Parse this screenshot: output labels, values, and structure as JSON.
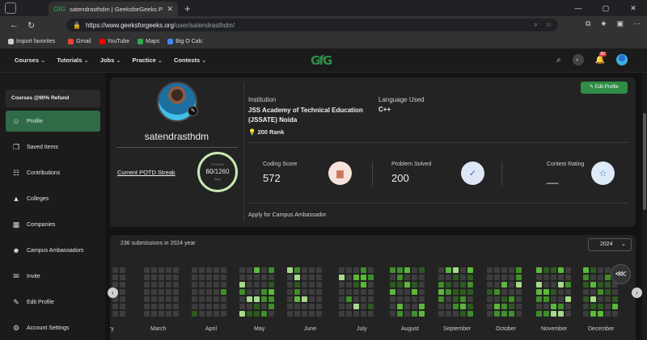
{
  "browser": {
    "tab_title": "satendrasthdm | GeeksforGeeks P",
    "tab_favicon": "GfG",
    "url_host": "https://www.geeksforgeeks.org",
    "url_path": "/user/satendrasthdm/",
    "bookmarks": [
      {
        "label": "Import favorites",
        "color": "#cccccc"
      },
      {
        "label": "Gmail",
        "color": "#ea4335"
      },
      {
        "label": "YouTube",
        "color": "#ff0000"
      },
      {
        "label": "Maps",
        "color": "#34a853"
      },
      {
        "label": "Big O Calc",
        "color": "#4285f4"
      }
    ]
  },
  "header": {
    "nav": [
      "Courses",
      "Tutorials",
      "Jobs",
      "Practice",
      "Contests"
    ],
    "logo": "GfG",
    "notification_count": "80"
  },
  "sidebar": {
    "refund_label": "Courses @90% Refund",
    "items": [
      {
        "label": "Profile",
        "icon": "user-icon",
        "glyph": "☺",
        "active": true
      },
      {
        "label": "Saved Items",
        "icon": "bookmark-icon",
        "glyph": "❐",
        "active": false
      },
      {
        "label": "Contributions",
        "icon": "document-icon",
        "glyph": "☷",
        "active": false
      },
      {
        "label": "Colleges",
        "icon": "graduation-cap-icon",
        "glyph": "▲",
        "active": false
      },
      {
        "label": "Companies",
        "icon": "building-icon",
        "glyph": "▦",
        "active": false
      },
      {
        "label": "Campus Ambassadors",
        "icon": "people-icon",
        "glyph": "☻",
        "active": false
      },
      {
        "label": "Invite",
        "icon": "mail-icon",
        "glyph": "✉",
        "active": false
      },
      {
        "label": "Edit Profile",
        "icon": "pencil-icon",
        "glyph": "✎",
        "active": false
      },
      {
        "label": "Account Settings",
        "icon": "gear-icon",
        "glyph": "⚙",
        "active": false
      }
    ]
  },
  "profile": {
    "username": "satendrasthdm",
    "potd_label": "Current POTD Streak",
    "streak_label": "STREAK",
    "streak_current": "60",
    "streak_total": "/1260",
    "streak_days": "days",
    "institution_label": "Institution",
    "institution": "JSS Academy of Technical Education (JSSATE) Noida",
    "rank": "200 Rank",
    "language_label": "Language Used",
    "language": "C++",
    "edit_label": "✎ Edit Profile",
    "stats": [
      {
        "label": "Coding Score",
        "value": "572",
        "icon": "bar-chart-icon",
        "glyph": "▆",
        "bg": "#f6e3dc",
        "fg": "#c9785a"
      },
      {
        "label": "Problem Solved",
        "value": "200",
        "icon": "check-circle-icon",
        "glyph": "✓",
        "bg": "#dfe6f5",
        "fg": "#3b5db0"
      },
      {
        "label": "Contest Rating",
        "value": "__",
        "icon": "star-icon",
        "glyph": "☆",
        "bg": "#dfeaf8",
        "fg": "#2d6cc0"
      }
    ],
    "ambassador_label": "Apply for Campus Ambassador"
  },
  "heatmap": {
    "submissions_label": "236 submissions in 2024 year",
    "year": "2024",
    "months": [
      "ary",
      "March",
      "April",
      "May",
      "June",
      "July",
      "August",
      "September",
      "October",
      "November",
      "December"
    ],
    "colors": [
      "#3d3d3d",
      "#2d5a1e",
      "#3f8f2a",
      "#5cb83a",
      "#a8d98a"
    ]
  }
}
